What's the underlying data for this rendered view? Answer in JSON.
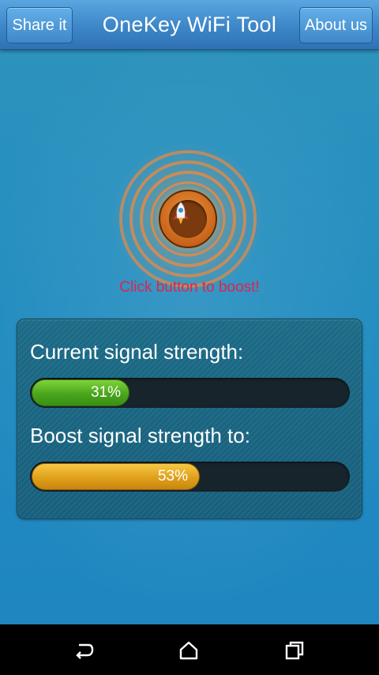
{
  "header": {
    "title": "OneKey WiFi Tool",
    "share_label": "Share it",
    "about_label": "About us"
  },
  "boost": {
    "icon": "rocket-icon",
    "hint": "Click button to boost!",
    "hint_color": "#e0244a"
  },
  "signal": {
    "current_label": "Current signal strength:",
    "current_value": 31,
    "current_text": "31%",
    "current_color": "#4aa51d",
    "boost_label": "Boost signal strength to:",
    "boost_value": 53,
    "boost_text": "53%",
    "boost_color": "#e0a01b"
  },
  "navbar": {
    "back_icon": "back-icon",
    "home_icon": "home-icon",
    "recent_icon": "recent-apps-icon"
  }
}
